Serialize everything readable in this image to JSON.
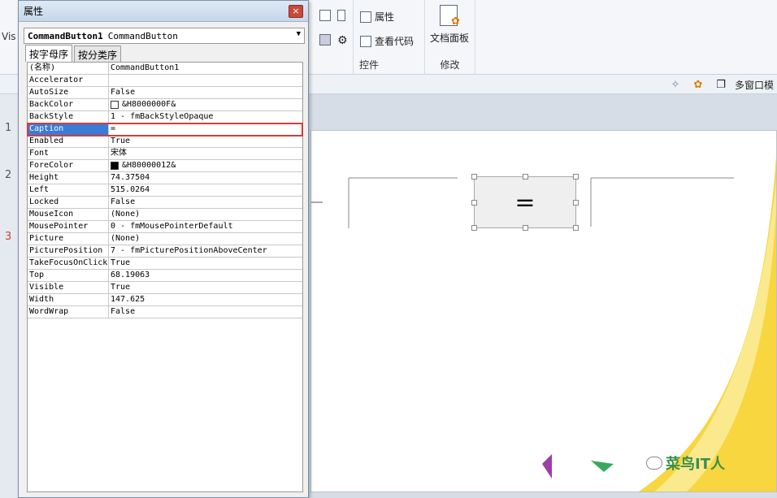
{
  "ribbon": {
    "left_text": "Vis",
    "controls_group_label": "控件",
    "modify_group_label": "修改",
    "properties_label": "属性",
    "view_code_label": "查看代码",
    "doc_panel_label": "文档面板"
  },
  "toolbar": {
    "multi_window_label": "多窗口模"
  },
  "left_numbers": [
    "1",
    "2",
    "3"
  ],
  "props": {
    "title": "属性",
    "close": "×",
    "object_name": "CommandButton1",
    "object_type": "CommandButton",
    "tabs": [
      "按字母序",
      "按分类序"
    ],
    "rows": [
      {
        "k": "(名称)",
        "v": "CommandButton1"
      },
      {
        "k": "Accelerator",
        "v": ""
      },
      {
        "k": "AutoSize",
        "v": "False"
      },
      {
        "k": "BackColor",
        "v": "&H8000000F&"
      },
      {
        "k": "BackStyle",
        "v": "1 - fmBackStyleOpaque"
      },
      {
        "k": "Caption",
        "v": "="
      },
      {
        "k": "Enabled",
        "v": "True"
      },
      {
        "k": "Font",
        "v": "宋体"
      },
      {
        "k": "ForeColor",
        "v": "&H80000012&"
      },
      {
        "k": "Height",
        "v": "74.37504"
      },
      {
        "k": "Left",
        "v": "515.0264"
      },
      {
        "k": "Locked",
        "v": "False"
      },
      {
        "k": "MouseIcon",
        "v": "(None)"
      },
      {
        "k": "MousePointer",
        "v": "0 - fmMousePointerDefault"
      },
      {
        "k": "Picture",
        "v": "(None)"
      },
      {
        "k": "PicturePosition",
        "v": "7 - fmPicturePositionAboveCenter"
      },
      {
        "k": "TakeFocusOnClick",
        "v": "True"
      },
      {
        "k": "Top",
        "v": "68.19063"
      },
      {
        "k": "Visible",
        "v": "True"
      },
      {
        "k": "Width",
        "v": "147.625"
      },
      {
        "k": "WordWrap",
        "v": "False"
      }
    ]
  },
  "slide": {
    "button_caption": "=",
    "watermark": "菜鸟IT人"
  },
  "colors": {
    "accent_yellow": "#f6c400",
    "selection_blue": "#3a7bd5",
    "highlight_red": "#d33c3c"
  }
}
